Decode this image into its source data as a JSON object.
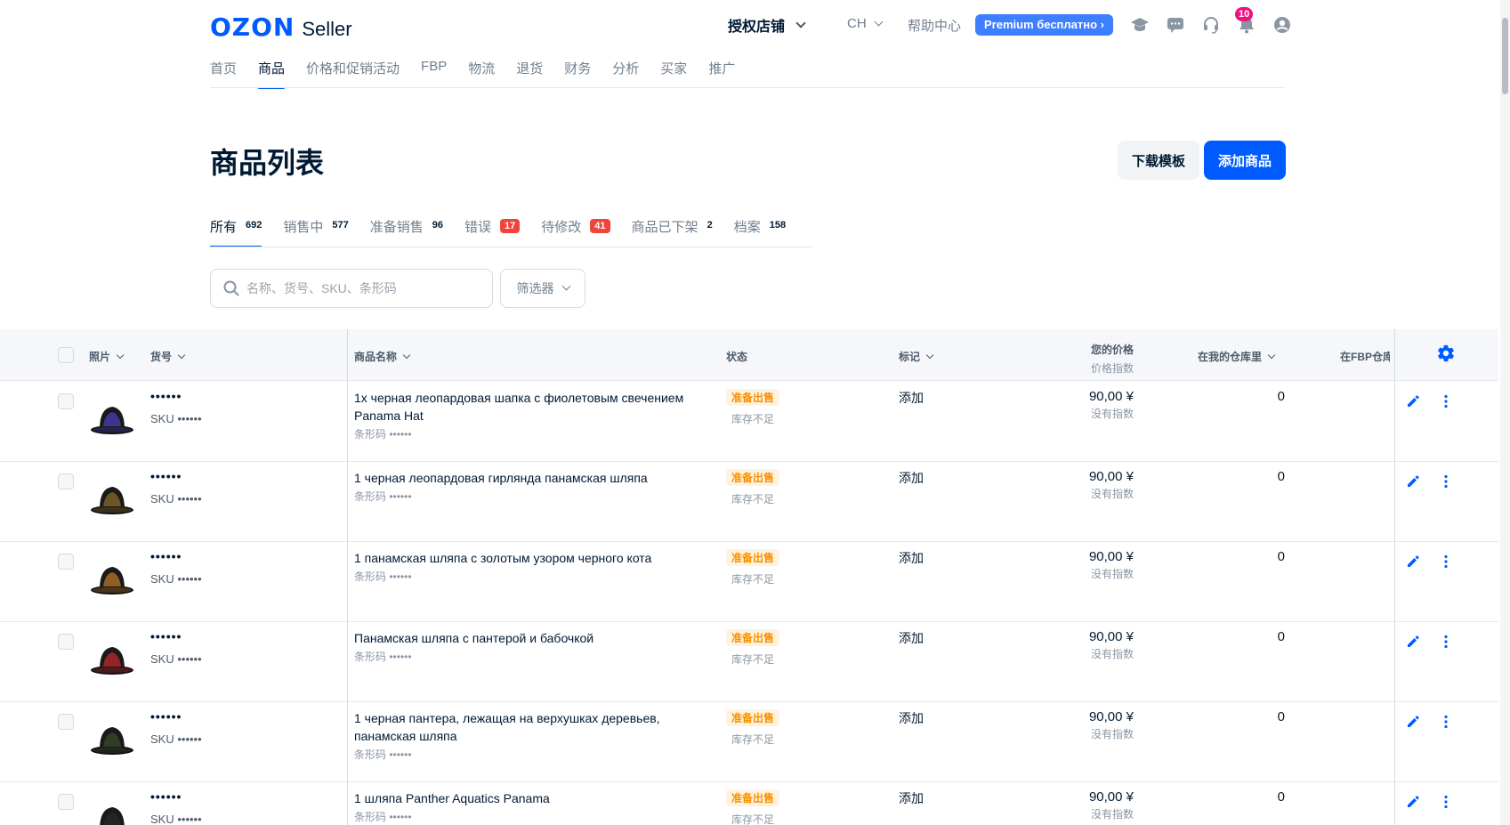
{
  "header": {
    "logo_ozon": "OZON",
    "logo_seller": "Seller",
    "store": "授权店铺",
    "lang": "CH",
    "help": "帮助中心",
    "premium": "Premium бесплатно ›",
    "notifications": "10",
    "nav": [
      "首页",
      "商品",
      "价格和促销活动",
      "FBP",
      "物流",
      "退货",
      "财务",
      "分析",
      "买家",
      "推广"
    ],
    "active_nav": 1
  },
  "page": {
    "title": "商品列表",
    "download_template": "下载模板",
    "add_product": "添加商品"
  },
  "tabs": [
    {
      "label": "所有",
      "count": "692",
      "red": false
    },
    {
      "label": "销售中",
      "count": "577",
      "red": false
    },
    {
      "label": "准备销售",
      "count": "96",
      "red": false
    },
    {
      "label": "错误",
      "count": "17",
      "red": true
    },
    {
      "label": "待修改",
      "count": "41",
      "red": true
    },
    {
      "label": "商品已下架",
      "count": "2",
      "red": false
    },
    {
      "label": "档案",
      "count": "158",
      "red": false
    }
  ],
  "search": {
    "placeholder": "名称、货号、SKU、条形码"
  },
  "filter": {
    "label": "筛选器"
  },
  "table": {
    "headers": {
      "photo": "照片",
      "article": "货号",
      "name": "商品名称",
      "status": "状态",
      "mark": "标记",
      "price": "您的价格",
      "price_sub": "价格指数",
      "stock": "在我的仓库里",
      "fbp": "在FBP仓库"
    },
    "rows": [
      {
        "article": "••••••",
        "sku": "SKU ••••••",
        "name": "1x черная леопардовая шапка с фиолетовым свечением Panama Hat",
        "barcode": "条形码 ••••••",
        "status": "准备出售",
        "status_sub": "库存不足",
        "mark": "添加",
        "price": "90,00 ¥",
        "price_sub": "没有指数",
        "stock": "0"
      },
      {
        "article": "••••••",
        "sku": "SKU ••••••",
        "name": "1 черная леопардовая гирлянда панамская шляпа",
        "barcode": "条形码 ••••••",
        "status": "准备出售",
        "status_sub": "库存不足",
        "mark": "添加",
        "price": "90,00 ¥",
        "price_sub": "没有指数",
        "stock": "0"
      },
      {
        "article": "••••••",
        "sku": "SKU ••••••",
        "name": "1 панамская шляпа с золотым узором черного кота",
        "barcode": "条形码 ••••••",
        "status": "准备出售",
        "status_sub": "库存不足",
        "mark": "添加",
        "price": "90,00 ¥",
        "price_sub": "没有指数",
        "stock": "0"
      },
      {
        "article": "••••••",
        "sku": "SKU ••••••",
        "name": "Панамская шляпа с пантерой и бабочкой",
        "barcode": "条形码 ••••••",
        "status": "准备出售",
        "status_sub": "库存不足",
        "mark": "添加",
        "price": "90,00 ¥",
        "price_sub": "没有指数",
        "stock": "0"
      },
      {
        "article": "••••••",
        "sku": "SKU ••••••",
        "name": "1 черная пантера, лежащая на верхушках деревьев, панамская шляпа",
        "barcode": "条形码 ••••••",
        "status": "准备出售",
        "status_sub": "库存不足",
        "mark": "添加",
        "price": "90,00 ¥",
        "price_sub": "没有指数",
        "stock": "0"
      },
      {
        "article": "••••••",
        "sku": "SKU ••••••",
        "name": "1 шляпа Panther Aquatics Panama",
        "barcode": "条形码 ••••••",
        "status": "准备出售",
        "status_sub": "库存不足",
        "mark": "添加",
        "price": "90,00 ¥",
        "price_sub": "没有指数",
        "stock": "0"
      }
    ]
  },
  "icons": {
    "hats": [
      "purple-hat-icon",
      "black-leopard-hat-icon",
      "gold-cat-hat-icon",
      "red-panther-hat-icon",
      "black-panther-hat-icon",
      "aquatics-hat-icon"
    ],
    "hat_colors": [
      "#4b3fb8",
      "#8a6a2a",
      "#b8742a",
      "#c0272d",
      "#3a4a2a",
      "#2a2a2a"
    ]
  },
  "colors": {
    "accent": "#005bff",
    "status_ready": "#f59100",
    "badge_red": "#f1443a"
  }
}
